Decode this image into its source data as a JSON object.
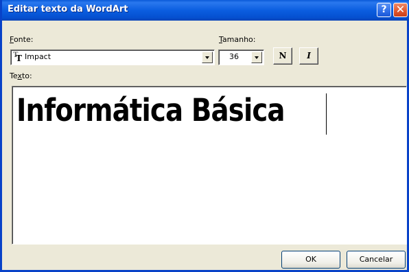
{
  "window": {
    "title": "Editar texto da WordArt",
    "help_label": "?",
    "close_label": "✕"
  },
  "font": {
    "label_accel": "F",
    "label_rest": "onte:",
    "value": "Impact",
    "icon": "truetype-font-icon"
  },
  "size": {
    "label_accel": "T",
    "label_rest": "amanho:",
    "value": "36"
  },
  "format": {
    "bold_label": "N",
    "italic_label": "I"
  },
  "text": {
    "label_pre": "Te",
    "label_accel": "x",
    "label_post": "to:",
    "value": "Informática Básica"
  },
  "buttons": {
    "ok_label": "OK",
    "cancel_label": "Cancelar"
  }
}
